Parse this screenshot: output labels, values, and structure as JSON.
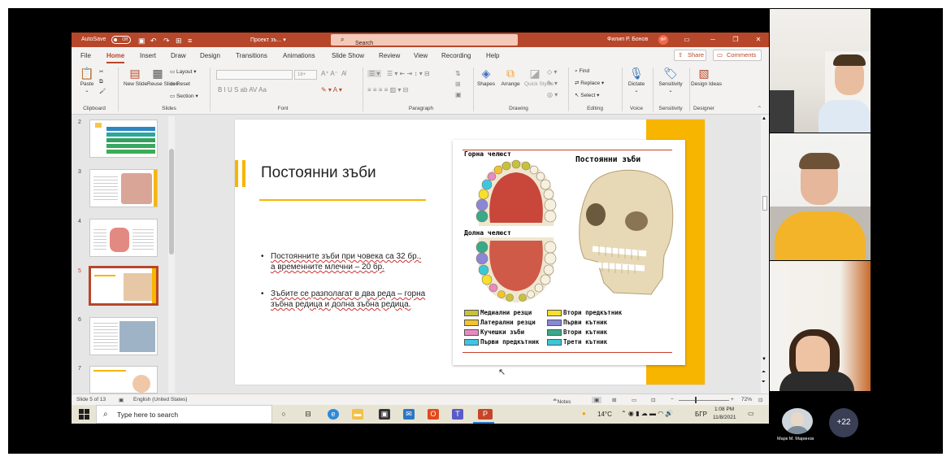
{
  "app": {
    "autosave_label": "AutoSave",
    "autosave_state": "Off",
    "doc_title": "Проект зъ... ▾",
    "search_placeholder": "Search",
    "user_name": "Филип Р. Бонов",
    "user_initials": "ФР"
  },
  "tabs": [
    "File",
    "Home",
    "Insert",
    "Draw",
    "Design",
    "Transitions",
    "Animations",
    "Slide Show",
    "Review",
    "View",
    "Recording",
    "Help"
  ],
  "active_tab": "Home",
  "share_label": "Share",
  "comments_label": "Comments",
  "ribbon": {
    "paste": "Paste",
    "new_slide": "New Slide",
    "reuse_slides": "Reuse Slides",
    "layout": "Layout",
    "reset": "Reset",
    "section": "Section",
    "font_size": "18+",
    "shapes": "Shapes",
    "arrange": "Arrange",
    "quick_styles": "Quick Styles",
    "find": "Find",
    "replace": "Replace",
    "select": "Select",
    "dictate": "Dictate",
    "sensitivity": "Sensitivity",
    "design_ideas": "Design Ideas",
    "groups": [
      "Clipboard",
      "Slides",
      "Font",
      "Paragraph",
      "Drawing",
      "Editing",
      "Voice",
      "Sensitivity",
      "Designer"
    ]
  },
  "thumbnails": [
    "2",
    "3",
    "4",
    "5",
    "6",
    "7"
  ],
  "selected_slide": "5",
  "slide": {
    "title": "Постоянни зъби",
    "bullet1": "Постоянните зъби при човека са 32 бр., а временните млечни – 20 бр.",
    "bullet2": "Зъбите се разполагат в два реда – горна зъбна редица и долна зъбна редица.",
    "figure": {
      "upper_jaw": "Горна челюст",
      "lower_jaw": "Долна челюст",
      "heading": "Постоянни зъби",
      "legend": [
        {
          "label": "Медиални резци",
          "color": "#c8c23a"
        },
        {
          "label": "Латерални резци",
          "color": "#f2c42a"
        },
        {
          "label": "Кучешки зъби",
          "color": "#e88ac0"
        },
        {
          "label": "Първи предкътник",
          "color": "#3cc6e6"
        },
        {
          "label": "Втори предкътник",
          "color": "#f6e02c"
        },
        {
          "label": "Първи кътник",
          "color": "#8a86d8"
        },
        {
          "label": "Втори кътник",
          "color": "#3aa88a"
        },
        {
          "label": "Трети кътник",
          "color": "#38c8d8"
        }
      ]
    },
    "accent": "#f7b500"
  },
  "status": {
    "slide_count": "Slide 5 of 13",
    "language": "English (United States)",
    "notes": "Notes",
    "zoom": "72%"
  },
  "taskbar": {
    "search_placeholder": "Type here to search",
    "temperature": "14°C",
    "lang": "БГР",
    "time": "1:08 PM",
    "date": "11/8/2021"
  },
  "meeting": {
    "participant_name": "Марк М. Маринов",
    "more_count": "+22"
  }
}
